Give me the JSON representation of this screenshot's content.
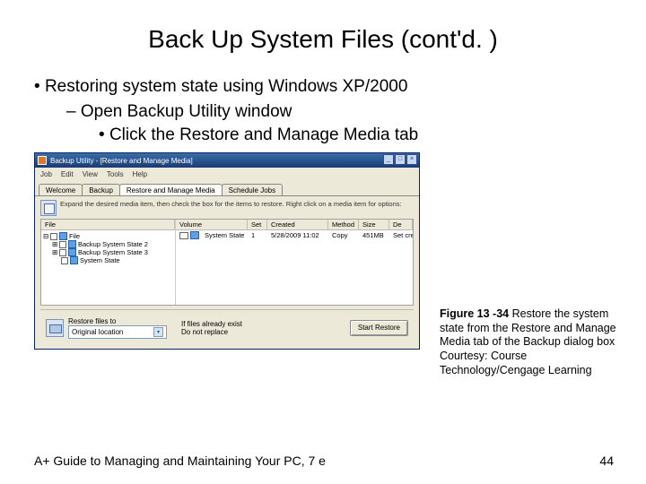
{
  "slide": {
    "title": "Back Up System Files (cont'd. )",
    "bullet1": "Restoring system state using Windows XP/2000",
    "bullet2": "Open Backup Utility window",
    "bullet3": "Click the Restore and Manage Media tab"
  },
  "screenshot": {
    "window_title": "Backup Utility - [Restore and Manage Media]",
    "menu": [
      "Job",
      "Edit",
      "View",
      "Tools",
      "Help"
    ],
    "tabs": [
      "Welcome",
      "Backup",
      "Restore and Manage Media",
      "Schedule Jobs"
    ],
    "active_tab_index": 2,
    "instruction": "Expand the desired media item, then check the box for the items to restore. Right click on a media item for options:",
    "left_header": "File",
    "tree": {
      "root": "File",
      "items": [
        "Backup System State 2",
        "Backup System State 3",
        "System State"
      ]
    },
    "right_headers": [
      "Volume",
      "Set",
      "Created",
      "Method",
      "Size",
      "De"
    ],
    "right_row": {
      "volume": "System State",
      "set": "1",
      "created": "5/28/2009 11:02",
      "method": "Copy",
      "size": "451MB",
      "de": "Set cre"
    },
    "restore_to_label": "Restore files to",
    "restore_to_value": "Original location",
    "exist_label": "If files already exist",
    "exist_value": "Do not replace",
    "start_button": "Start Restore"
  },
  "caption": {
    "fig_label": "Figure 13 -34 ",
    "fig_text": "Restore the system state from the Restore and Manage Media tab of the Backup dialog box",
    "courtesy": "Courtesy: Course Technology/Cengage Learning"
  },
  "footer": {
    "left": "A+ Guide to Managing and Maintaining Your PC, 7 e",
    "page": "44"
  }
}
